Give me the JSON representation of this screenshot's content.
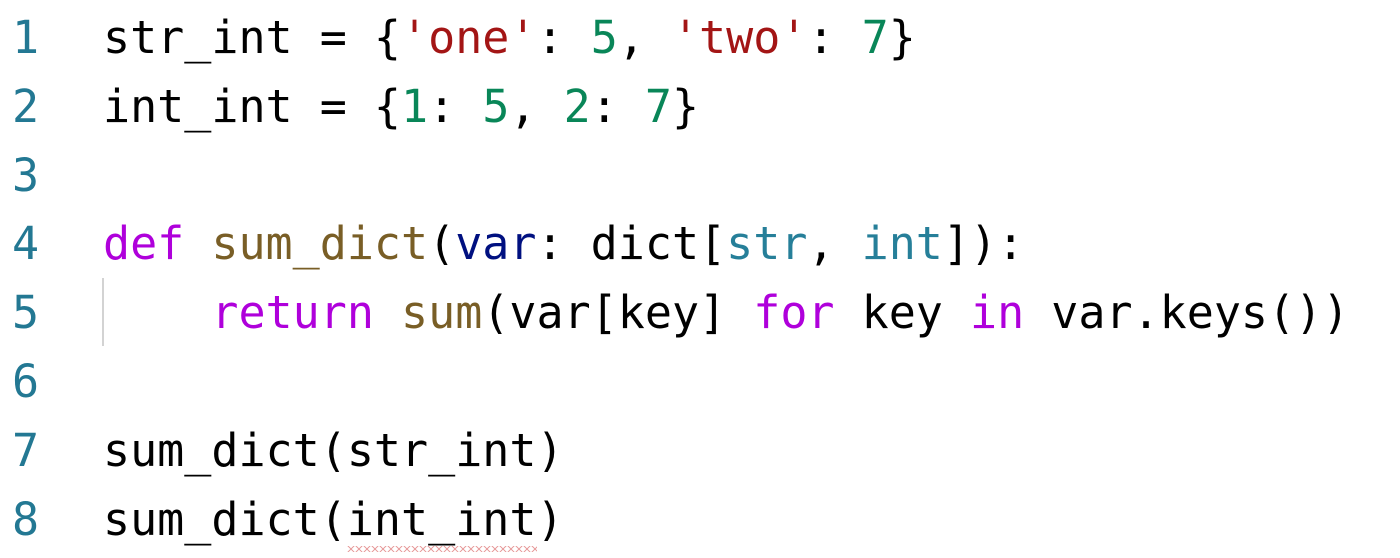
{
  "lines": [
    {
      "number": "1",
      "tokens": [
        {
          "text": "str_int",
          "kind": "plain"
        },
        {
          "text": " = {",
          "kind": "punc"
        },
        {
          "text": "'one'",
          "kind": "str"
        },
        {
          "text": ": ",
          "kind": "punc"
        },
        {
          "text": "5",
          "kind": "num"
        },
        {
          "text": ", ",
          "kind": "punc"
        },
        {
          "text": "'two'",
          "kind": "str"
        },
        {
          "text": ": ",
          "kind": "punc"
        },
        {
          "text": "7",
          "kind": "num"
        },
        {
          "text": "}",
          "kind": "punc"
        }
      ]
    },
    {
      "number": "2",
      "tokens": [
        {
          "text": "int_int",
          "kind": "plain"
        },
        {
          "text": " = {",
          "kind": "punc"
        },
        {
          "text": "1",
          "kind": "num"
        },
        {
          "text": ": ",
          "kind": "punc"
        },
        {
          "text": "5",
          "kind": "num"
        },
        {
          "text": ", ",
          "kind": "punc"
        },
        {
          "text": "2",
          "kind": "num"
        },
        {
          "text": ": ",
          "kind": "punc"
        },
        {
          "text": "7",
          "kind": "num"
        },
        {
          "text": "}",
          "kind": "punc"
        }
      ]
    },
    {
      "number": "3",
      "tokens": []
    },
    {
      "number": "4",
      "tokens": [
        {
          "text": "def",
          "kind": "kw"
        },
        {
          "text": " ",
          "kind": "plain"
        },
        {
          "text": "sum_dict",
          "kind": "fn"
        },
        {
          "text": "(",
          "kind": "punc"
        },
        {
          "text": "var",
          "kind": "param"
        },
        {
          "text": ": dict[",
          "kind": "punc"
        },
        {
          "text": "str",
          "kind": "type"
        },
        {
          "text": ", ",
          "kind": "punc"
        },
        {
          "text": "int",
          "kind": "type"
        },
        {
          "text": "]):",
          "kind": "punc"
        }
      ]
    },
    {
      "number": "5",
      "tokens": [
        {
          "text": "    ",
          "kind": "plain"
        },
        {
          "text": "return",
          "kind": "ctrl"
        },
        {
          "text": " ",
          "kind": "plain"
        },
        {
          "text": "sum",
          "kind": "fn"
        },
        {
          "text": "(var[key] ",
          "kind": "plain"
        },
        {
          "text": "for",
          "kind": "ctrl"
        },
        {
          "text": " key ",
          "kind": "plain"
        },
        {
          "text": "in",
          "kind": "ctrl"
        },
        {
          "text": " var.keys())",
          "kind": "plain"
        }
      ]
    },
    {
      "number": "6",
      "tokens": []
    },
    {
      "number": "7",
      "tokens": [
        {
          "text": "sum_dict",
          "kind": "plain"
        },
        {
          "text": "(",
          "kind": "punc"
        },
        {
          "text": "str_int",
          "kind": "plain"
        },
        {
          "text": ")",
          "kind": "punc"
        }
      ]
    },
    {
      "number": "8",
      "tokens": [
        {
          "text": "sum_dict",
          "kind": "plain"
        },
        {
          "text": "(",
          "kind": "punc"
        },
        {
          "text": "int_int",
          "kind": "plain",
          "squiggle": true
        },
        {
          "text": ")",
          "kind": "punc"
        }
      ]
    }
  ],
  "colors": {
    "line_number": "#237893",
    "keyword": "#af00db",
    "function": "#795e26",
    "string": "#a31515",
    "number": "#098658",
    "type": "#267f99",
    "parameter": "#001080",
    "error_squiggle": "#e8a0a0",
    "indent_guide": "#d3d3d3"
  }
}
